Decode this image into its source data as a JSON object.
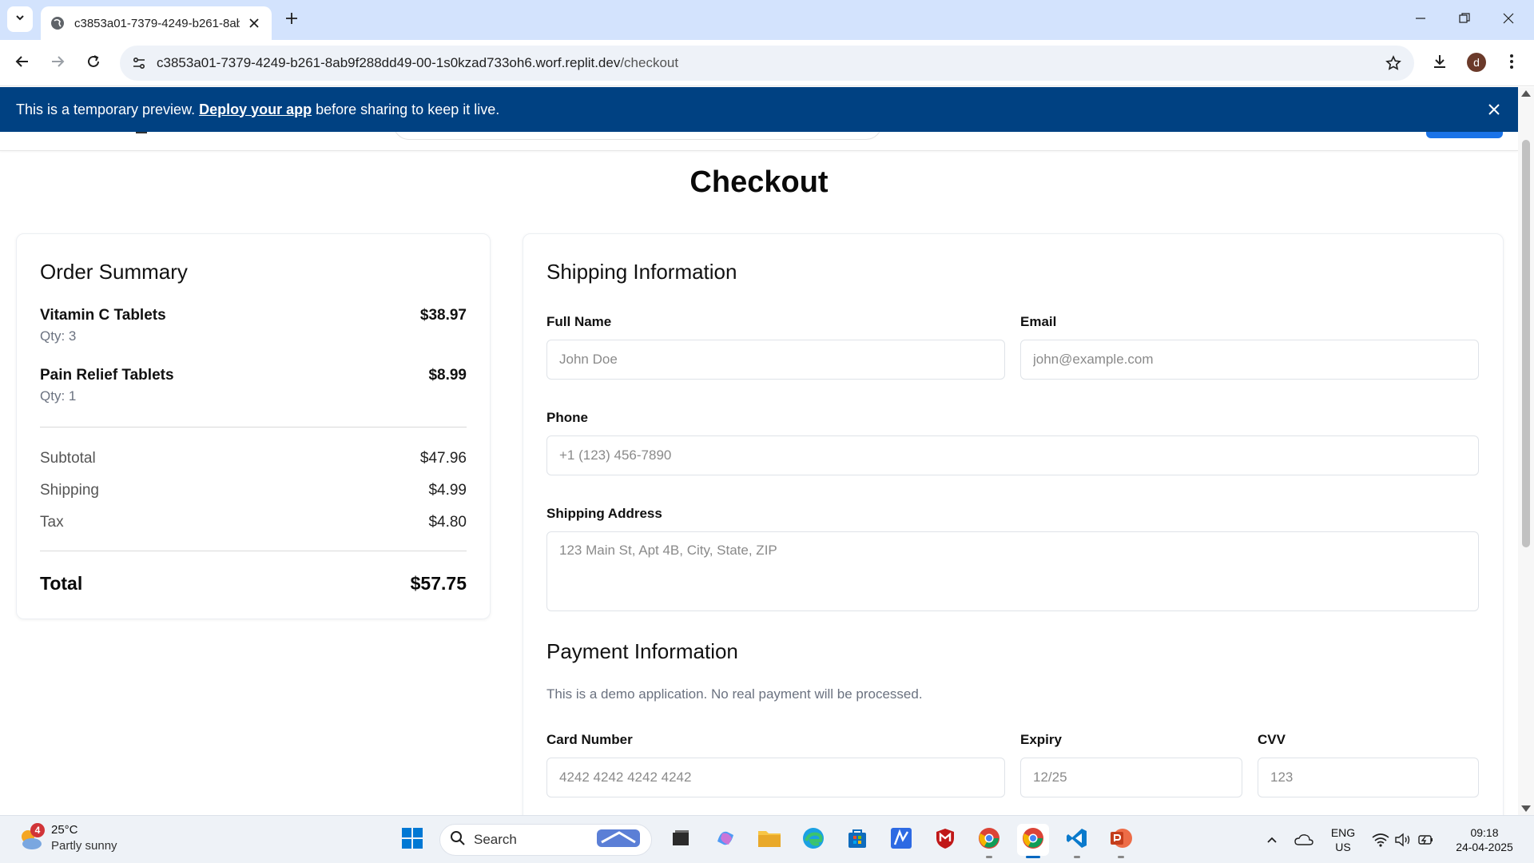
{
  "browser": {
    "tab_title": "c3853a01-7379-4249-b261-8ab9f288dd49-00-1s0kzad733oh6.worf.replit.dev/checkout",
    "url_host": "c3853a01-7379-4249-b261-8ab9f288dd49-00-1s0kzad733oh6.worf.replit.dev",
    "url_path": "/checkout",
    "profile_initial": "d"
  },
  "banner": {
    "prefix": "This is a temporary preview.",
    "link": "Deploy your app",
    "suffix": "before sharing to keep it live."
  },
  "page": {
    "title": "Checkout"
  },
  "order_summary": {
    "heading": "Order Summary",
    "items": [
      {
        "name": "Vitamin C Tablets",
        "qty": "Qty: 3",
        "price": "$38.97"
      },
      {
        "name": "Pain Relief Tablets",
        "qty": "Qty: 1",
        "price": "$8.99"
      }
    ],
    "subtotal_label": "Subtotal",
    "subtotal": "$47.96",
    "shipping_label": "Shipping",
    "shipping": "$4.99",
    "tax_label": "Tax",
    "tax": "$4.80",
    "total_label": "Total",
    "total": "$57.75"
  },
  "shipping_form": {
    "heading": "Shipping Information",
    "full_name_label": "Full Name",
    "full_name_placeholder": "John Doe",
    "email_label": "Email",
    "email_placeholder": "john@example.com",
    "phone_label": "Phone",
    "phone_placeholder": "+1 (123) 456-7890",
    "address_label": "Shipping Address",
    "address_placeholder": "123 Main St, Apt 4B, City, State, ZIP"
  },
  "payment_form": {
    "heading": "Payment Information",
    "note": "This is a demo application. No real payment will be processed.",
    "card_label": "Card Number",
    "card_placeholder": "4242 4242 4242 4242",
    "expiry_label": "Expiry",
    "expiry_placeholder": "12/25",
    "cvv_label": "CVV",
    "cvv_placeholder": "123"
  },
  "taskbar": {
    "weather_badge": "4",
    "weather_temp": "25°C",
    "weather_desc": "Partly sunny",
    "search_label": "Search",
    "lang_top": "ENG",
    "lang_bottom": "US",
    "time": "09:18",
    "date": "24-04-2025"
  },
  "colors": {
    "banner": "#004182",
    "tabbar": "#d3e3fd",
    "accent": "#1a73e8"
  }
}
